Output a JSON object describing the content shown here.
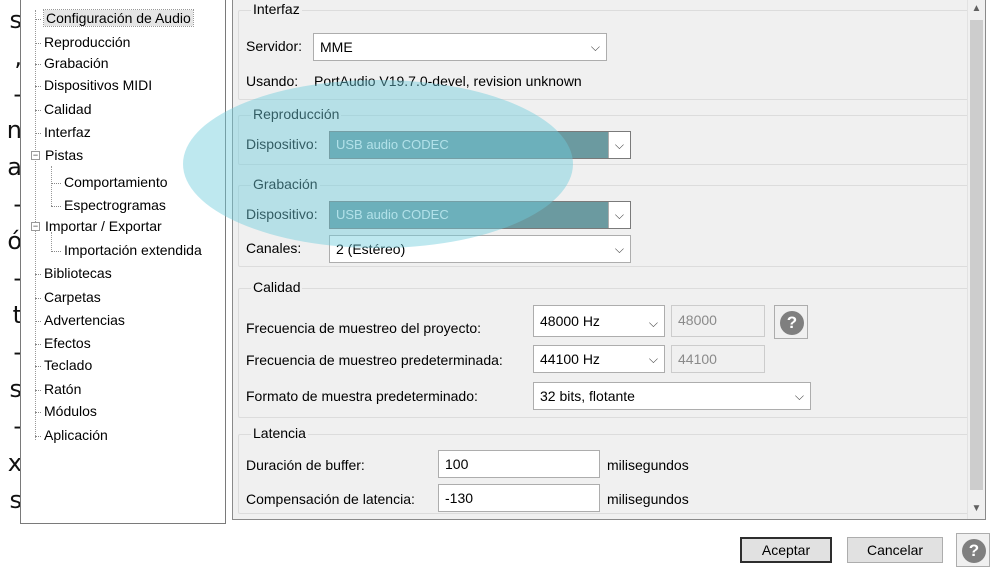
{
  "left_cut_chars": [
    "s",
    ",",
    "-",
    "n",
    "a",
    "-",
    "ó",
    "-",
    "t",
    "-",
    "s",
    "-",
    "x",
    "s"
  ],
  "tree": {
    "items": [
      {
        "label": "Configuración de Audio",
        "selected": true
      },
      {
        "label": "Reproducción"
      },
      {
        "label": "Grabación"
      },
      {
        "label": "Dispositivos MIDI"
      },
      {
        "label": "Calidad"
      },
      {
        "label": "Interfaz"
      },
      {
        "label": "Pistas",
        "expander": "−"
      },
      {
        "label": "Comportamiento"
      },
      {
        "label": "Espectrogramas"
      },
      {
        "label": "Importar / Exportar",
        "expander": "−"
      },
      {
        "label": "Importación extendida"
      },
      {
        "label": "Bibliotecas"
      },
      {
        "label": "Carpetas"
      },
      {
        "label": "Advertencias"
      },
      {
        "label": "Efectos"
      },
      {
        "label": "Teclado"
      },
      {
        "label": "Ratón"
      },
      {
        "label": "Módulos"
      },
      {
        "label": "Aplicación"
      }
    ]
  },
  "interfaz": {
    "title": "Interfaz",
    "host_label": "Servidor:",
    "host_value": "MME",
    "using_label": "Usando:",
    "using_value": "PortAudio V19.7.0-devel, revision unknown"
  },
  "playback": {
    "title": "Reproducción",
    "device_label": "Dispositivo:",
    "device_value": "USB audio CODEC"
  },
  "recording": {
    "title": "Grabación",
    "device_label": "Dispositivo:",
    "device_value": "USB audio CODEC",
    "channels_label": "Canales:",
    "channels_value": "2 (Estéreo)"
  },
  "quality": {
    "title": "Calidad",
    "project_rate_label": "Frecuencia de muestreo del proyecto:",
    "project_rate_value": "48000 Hz",
    "project_rate_text": "48000",
    "default_rate_label": "Frecuencia de muestreo predeterminada:",
    "default_rate_value": "44100 Hz",
    "default_rate_text": "44100",
    "format_label": "Formato de muestra predeterminado:",
    "format_value": "32 bits, flotante"
  },
  "latency": {
    "title": "Latencia",
    "buffer_label": "Duración de buffer:",
    "buffer_value": "100",
    "buffer_unit": "milisegundos",
    "comp_label": "Compensación de latencia:",
    "comp_value": "-130",
    "comp_unit": "milisegundos"
  },
  "footer": {
    "ok_label": "Aceptar",
    "cancel_label": "Cancelar",
    "help_glyph": "?"
  },
  "icons": {
    "dropdown": "chevron-down-icon",
    "help": "help-icon"
  },
  "colors": {
    "highlight_ellipse": "#6ecddc",
    "device_combo": "#6b9aa0"
  }
}
